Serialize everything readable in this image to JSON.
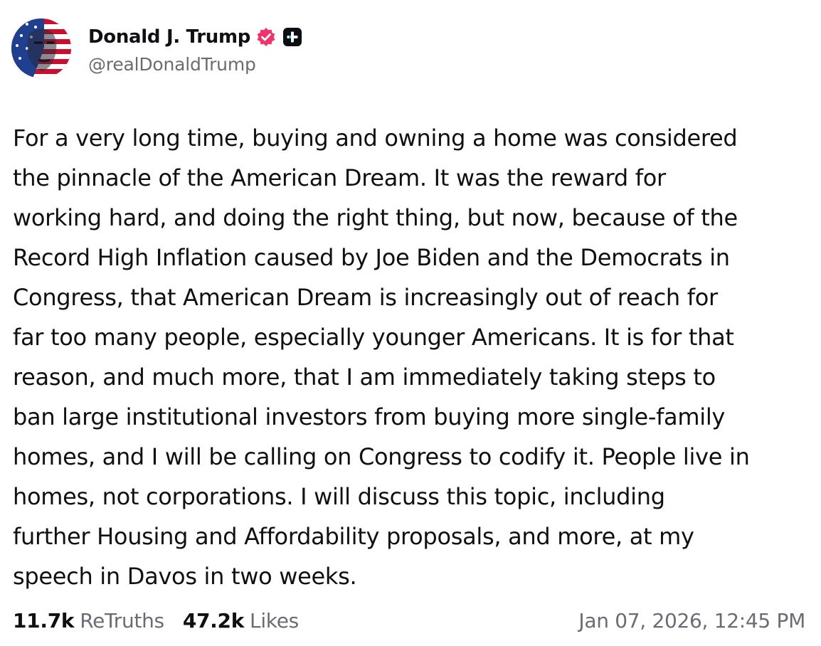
{
  "author": {
    "display_name": "Donald J. Trump",
    "handle": "@realDonaldTrump",
    "verified_badge_color": "#f0346a",
    "plus_badge_color": "#0d0d14",
    "avatar_icon": "american-flag-portrait"
  },
  "post": {
    "lines": [
      "For a very long time, buying and owning a home was considered",
      "the pinnacle of the American Dream. It was the reward for",
      "working hard, and doing the right thing, but now, because of the",
      "Record High Inflation caused by Joe Biden and the Democrats in",
      "Congress, that American Dream is increasingly out of reach for",
      "far too many people, especially younger Americans. It is for that",
      "reason, and much more, that I am immediately taking steps to",
      "ban large institutional investors from buying more single-family",
      "homes, and I will be calling on Congress to codify it. People live in",
      "homes, not corporations. I will discuss this topic, including",
      "further Housing and Affordability proposals, and more, at my",
      "speech in Davos in two weeks."
    ]
  },
  "stats": {
    "retruths_count": "11.7k",
    "retruths_label": "ReTruths",
    "likes_count": "47.2k",
    "likes_label": "Likes"
  },
  "timestamp": "Jan 07, 2026, 12:45 PM",
  "colors": {
    "text_primary": "#0f0f14",
    "text_secondary": "#6b6b75",
    "background": "#ffffff"
  }
}
